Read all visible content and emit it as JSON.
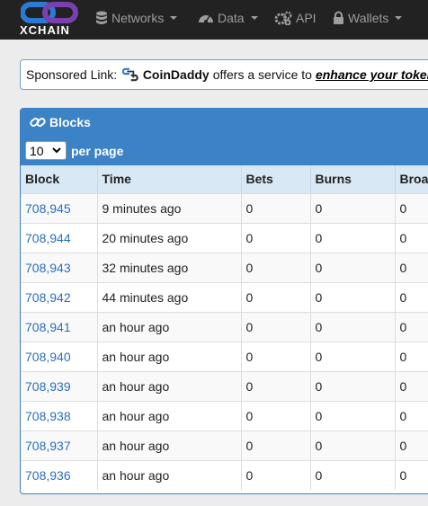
{
  "navbar": {
    "brand": "XCHAIN",
    "items": [
      {
        "label": "Networks",
        "icon": "database-icon",
        "dropdown": true
      },
      {
        "label": "Data",
        "icon": "dashboard-icon",
        "dropdown": true
      },
      {
        "label": "API",
        "icon": "gears-icon",
        "dropdown": false
      },
      {
        "label": "Wallets",
        "icon": "lock-icon",
        "dropdown": true
      }
    ]
  },
  "sponsor": {
    "prefix": "Sponsored Link:",
    "name": "CoinDaddy",
    "middle": "offers a service to",
    "link_text": "enhance your tokens"
  },
  "panel": {
    "title": "Blocks",
    "page_size": "10",
    "per_page_label": "per page",
    "columns": [
      "Block",
      "Time",
      "Bets",
      "Burns",
      "Broadcasts"
    ],
    "rows": [
      {
        "block": "708,945",
        "time": "9 minutes ago",
        "bets": "0",
        "burns": "0",
        "broadcasts": "0"
      },
      {
        "block": "708,944",
        "time": "20 minutes ago",
        "bets": "0",
        "burns": "0",
        "broadcasts": "0"
      },
      {
        "block": "708,943",
        "time": "32 minutes ago",
        "bets": "0",
        "burns": "0",
        "broadcasts": "0"
      },
      {
        "block": "708,942",
        "time": "44 minutes ago",
        "bets": "0",
        "burns": "0",
        "broadcasts": "0"
      },
      {
        "block": "708,941",
        "time": "an hour ago",
        "bets": "0",
        "burns": "0",
        "broadcasts": "0"
      },
      {
        "block": "708,940",
        "time": "an hour ago",
        "bets": "0",
        "burns": "0",
        "broadcasts": "0"
      },
      {
        "block": "708,939",
        "time": "an hour ago",
        "bets": "0",
        "burns": "0",
        "broadcasts": "0"
      },
      {
        "block": "708,938",
        "time": "an hour ago",
        "bets": "0",
        "burns": "0",
        "broadcasts": "0"
      },
      {
        "block": "708,937",
        "time": "an hour ago",
        "bets": "0",
        "burns": "0",
        "broadcasts": "0"
      },
      {
        "block": "708,936",
        "time": "an hour ago",
        "bets": "0",
        "burns": "0",
        "broadcasts": "0"
      }
    ]
  },
  "colors": {
    "navbar_bg": "#222222",
    "panel_header": "#3b82c6",
    "link": "#2a6ebb",
    "brand_blue": "#2a7bd4",
    "brand_purple": "#7a3fb0"
  }
}
